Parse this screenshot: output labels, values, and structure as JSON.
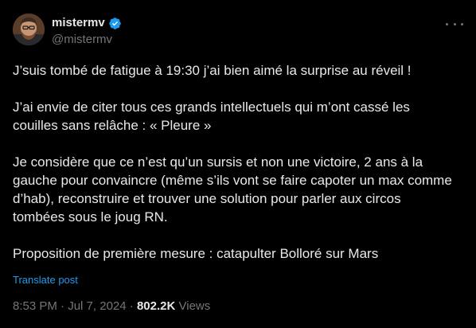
{
  "author": {
    "display_name": "mistermv",
    "handle": "@mistermv",
    "verified": true,
    "avatar_icon": "avatar-photo",
    "verified_icon": "verified-badge-icon",
    "verified_color": "#1d9bf0"
  },
  "tweet": {
    "paragraphs": [
      "J’suis tombé de fatigue à 19:30 j’ai bien aimé la surprise au réveil !",
      "J’ai envie de citer tous ces grands intellectuels qui m’ont cassé les\ncouilles sans relâche : « Pleure »",
      "Je considère que ce n’est qu’un sursis et non une victoire, 2 ans à la\ngauche pour convaincre (même s’ils vont se faire capoter un max comme\nd’hab), reconstruire et trouver une solution pour parler aux circos\ntombées sous le joug RN.",
      "Proposition de première mesure : catapulter Bolloré sur Mars"
    ],
    "translate_label": "Translate post"
  },
  "meta": {
    "time": "8:53 PM",
    "separator": "·",
    "date": "Jul 7, 2024",
    "views_count": "802.2K",
    "views_label": "Views"
  },
  "menu": {
    "more_icon": "more-horizontal-icon"
  },
  "colors": {
    "background": "#000000",
    "text_primary": "#e7e9ea",
    "text_secondary": "#71767b",
    "accent": "#1d9bf0"
  }
}
